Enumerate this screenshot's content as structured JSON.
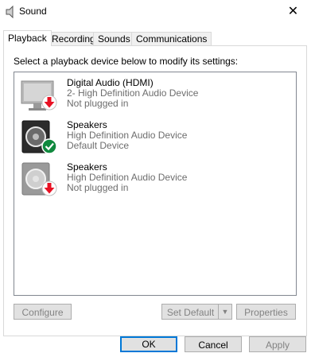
{
  "window": {
    "title": "Sound",
    "close_glyph": "✕"
  },
  "tabs": [
    {
      "label": "Playback",
      "active": true
    },
    {
      "label": "Recording"
    },
    {
      "label": "Sounds"
    },
    {
      "label": "Communications"
    }
  ],
  "playback": {
    "intro": "Select a playback device below to modify its settings:",
    "devices": [
      {
        "name": "Digital Audio (HDMI)",
        "line2": "2- High Definition Audio Device",
        "status": "Not plugged in",
        "icon": "monitor-icon",
        "badge": "not-plugged-in-badge",
        "badge_color": "#e81123"
      },
      {
        "name": "Speakers",
        "line2": "High Definition Audio Device",
        "status": "Default Device",
        "icon": "speaker-icon",
        "badge": "default-device-check-badge",
        "badge_color": "#10893e"
      },
      {
        "name": "Speakers",
        "line2": "High Definition Audio Device",
        "status": "Not plugged in",
        "icon": "speaker-icon",
        "badge": "not-plugged-in-badge",
        "badge_color": "#e81123"
      }
    ],
    "buttons": {
      "configure": "Configure",
      "set_default": "Set Default",
      "properties": "Properties"
    }
  },
  "dialog_buttons": {
    "ok": "OK",
    "cancel": "Cancel",
    "apply": "Apply"
  },
  "colors": {
    "accent": "#0078d7",
    "disabled_text": "#838383",
    "secondary_text": "#6d6d6d"
  }
}
